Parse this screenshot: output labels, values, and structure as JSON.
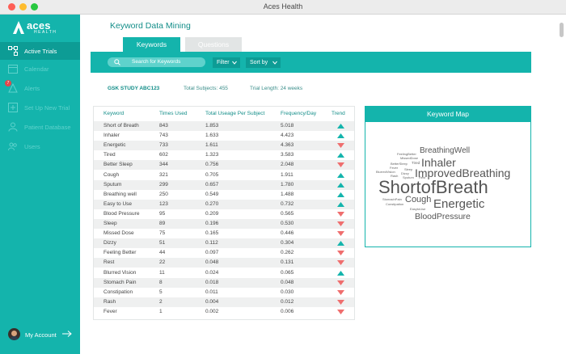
{
  "window": {
    "title": "Aces Health"
  },
  "brand": {
    "name": "aces",
    "sub": "HEALTH"
  },
  "nav": [
    {
      "label": "Active Trials",
      "icon": "network-icon",
      "active": true
    },
    {
      "label": "Calendar",
      "icon": "calendar-icon",
      "active": false
    },
    {
      "label": "Alerts",
      "icon": "alert-icon",
      "active": false,
      "badge": "7"
    },
    {
      "label": "Set Up New Trial",
      "icon": "setup-icon",
      "active": false
    },
    {
      "label": "Patient Database",
      "icon": "person-icon",
      "active": false
    },
    {
      "label": "Users",
      "icon": "users-icon",
      "active": false
    }
  ],
  "account": {
    "label": "My Account"
  },
  "page": {
    "title": "Keyword Data Mining"
  },
  "tabs": [
    {
      "label": "Keywords",
      "active": true
    },
    {
      "label": "Questions",
      "active": false
    }
  ],
  "toolbar": {
    "search_placeholder": "Search for Keywords",
    "filter_label": "Filter",
    "sort_label": "Sort by"
  },
  "study": {
    "name": "GSK STUDY ABC123",
    "subjects": "Total Subjects: 455",
    "length": "Trial Length: 24 weeks"
  },
  "table": {
    "headers": [
      "Keyword",
      "Times Used",
      "Total Useage Per Subject",
      "Frequency/Day",
      "Trend"
    ],
    "rows": [
      [
        "Short of Breath",
        "843",
        "1.853",
        "5.018",
        "up"
      ],
      [
        "Inhaler",
        "743",
        "1.633",
        "4.423",
        "up"
      ],
      [
        "Energetic",
        "733",
        "1.611",
        "4.363",
        "down"
      ],
      [
        "Tired",
        "602",
        "1.323",
        "3.583",
        "up"
      ],
      [
        "Better Sleep",
        "344",
        "0.756",
        "2.048",
        "down"
      ],
      [
        "Cough",
        "321",
        "0.705",
        "1.911",
        "up"
      ],
      [
        "Sputum",
        "299",
        "0.657",
        "1.780",
        "up"
      ],
      [
        "Breathing well",
        "250",
        "0.549",
        "1.488",
        "up"
      ],
      [
        "Easy to Use",
        "123",
        "0.270",
        "0.732",
        "up"
      ],
      [
        "Blood Pressure",
        "95",
        "0.209",
        "0.565",
        "down"
      ],
      [
        "Sleep",
        "89",
        "0.196",
        "0.530",
        "down"
      ],
      [
        "Missed Dose",
        "75",
        "0.165",
        "0.446",
        "down"
      ],
      [
        "Dizzy",
        "51",
        "0.112",
        "0.304",
        "up"
      ],
      [
        "Feeling Better",
        "44",
        "0.097",
        "0.262",
        "down"
      ],
      [
        "Rest",
        "22",
        "0.048",
        "0.131",
        "down"
      ],
      [
        "Blurred Vision",
        "11",
        "0.024",
        "0.065",
        "up"
      ],
      [
        "Stomach Pain",
        "8",
        "0.018",
        "0.048",
        "down"
      ],
      [
        "Constipation",
        "5",
        "0.011",
        "0.030",
        "down"
      ],
      [
        "Rash",
        "2",
        "0.004",
        "0.012",
        "down"
      ],
      [
        "Fever",
        "1",
        "0.002",
        "0.006",
        "down"
      ]
    ]
  },
  "keyword_map": {
    "title": "Keyword Map",
    "words": [
      "BreathingWell",
      "Inhaler",
      "ImprovedBreathing",
      "ShortofBreath",
      "Cough",
      "Energetic",
      "BloodPressure",
      "FeelingBetter",
      "MissedDose",
      "BetterSleep",
      "Tired",
      "Fever",
      "Sleep",
      "BlurredVision",
      "Dizzy",
      "Rash",
      "Sputum",
      "Rest",
      "StomachPain",
      "Constipation",
      "EasytoUse"
    ]
  },
  "colors": {
    "accent": "#14b4ac",
    "accent_dark": "#0d9c95",
    "trend_up": "#14b4ac",
    "trend_down": "#ef6e6e"
  }
}
